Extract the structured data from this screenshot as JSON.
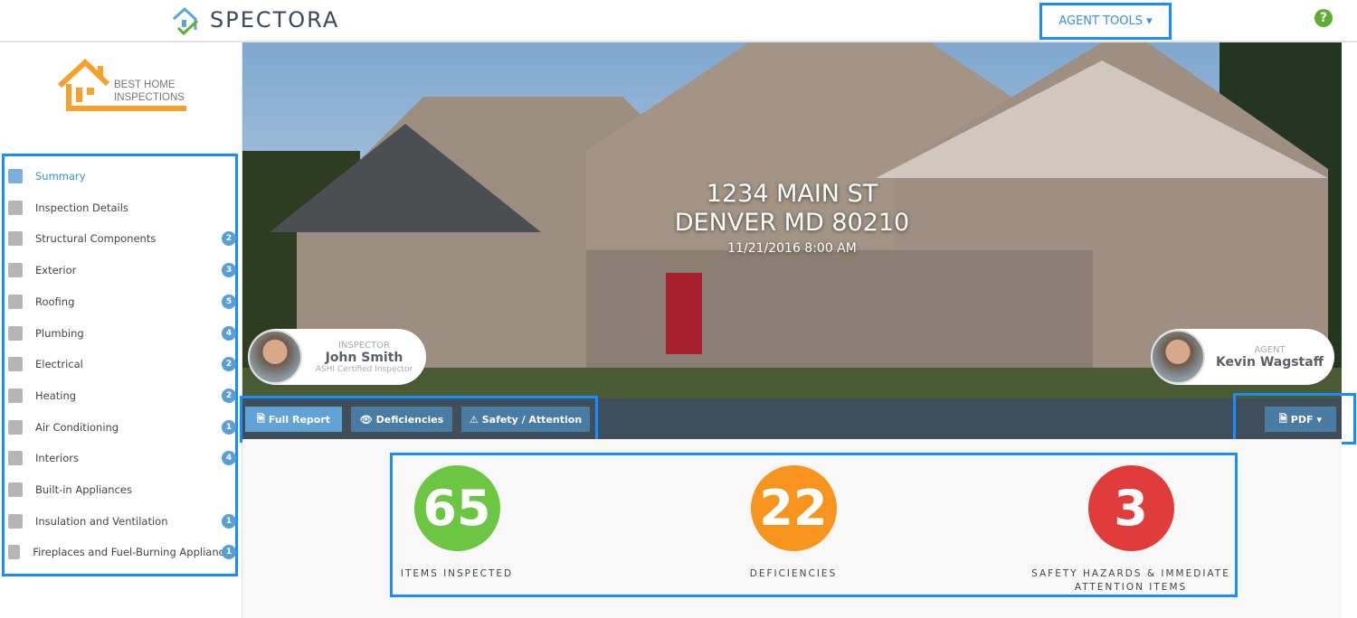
{
  "header": {
    "brand": "SPECTORA",
    "agent_tools": "AGENT TOOLS",
    "help_icon": "?"
  },
  "company_logo": {
    "line1": "BEST HOME",
    "line2": "INSPECTIONS"
  },
  "sidebar": {
    "items": [
      {
        "label": "Summary",
        "icon": "document-icon",
        "badge": null,
        "active": true
      },
      {
        "label": "Inspection Details",
        "icon": "details-icon",
        "badge": null
      },
      {
        "label": "Structural Components",
        "icon": "structure-icon",
        "badge": "2"
      },
      {
        "label": "Exterior",
        "icon": "fence-icon",
        "badge": "3"
      },
      {
        "label": "Roofing",
        "icon": "roof-icon",
        "badge": "5"
      },
      {
        "label": "Plumbing",
        "icon": "pipe-icon",
        "badge": "4"
      },
      {
        "label": "Electrical",
        "icon": "panel-icon",
        "badge": "2"
      },
      {
        "label": "Heating",
        "icon": "flame-house-icon",
        "badge": "2"
      },
      {
        "label": "Air Conditioning",
        "icon": "snowflake-icon",
        "badge": "1"
      },
      {
        "label": "Interiors",
        "icon": "door-icon",
        "badge": "4"
      },
      {
        "label": "Built-in Appliances",
        "icon": "fridge-icon",
        "badge": null
      },
      {
        "label": "Insulation and Ventilation",
        "icon": "fan-icon",
        "badge": "1"
      },
      {
        "label": "Fireplaces and Fuel-Burning Appliances",
        "icon": "fireplace-icon",
        "badge": "1"
      }
    ]
  },
  "hero": {
    "street": "1234 MAIN ST",
    "city": "DENVER MD 80210",
    "datetime": "11/21/2016 8:00 AM"
  },
  "inspector": {
    "role": "INSPECTOR",
    "name": "John Smith",
    "credential": "ASHI Certified Inspector"
  },
  "agent": {
    "role": "AGENT",
    "name": "Kevin Wagstaff"
  },
  "toolbar": {
    "full_report": "Full Report",
    "deficiencies": "Deficiencies",
    "safety": "Safety / Attention",
    "pdf": "PDF"
  },
  "stats": [
    {
      "value": "65",
      "label": "ITEMS INSPECTED",
      "color": "#6cc644"
    },
    {
      "value": "22",
      "label": "DEFICIENCIES",
      "color": "#f7941d"
    },
    {
      "value": "3",
      "label": "SAFETY HAZARDS & IMMEDIATE ATTENTION ITEMS",
      "color": "#e03c3c"
    }
  ],
  "colors": {
    "accent": "#3a8fd6",
    "toolbar": "#3f4e5b",
    "highlight": "#1a8cff"
  }
}
